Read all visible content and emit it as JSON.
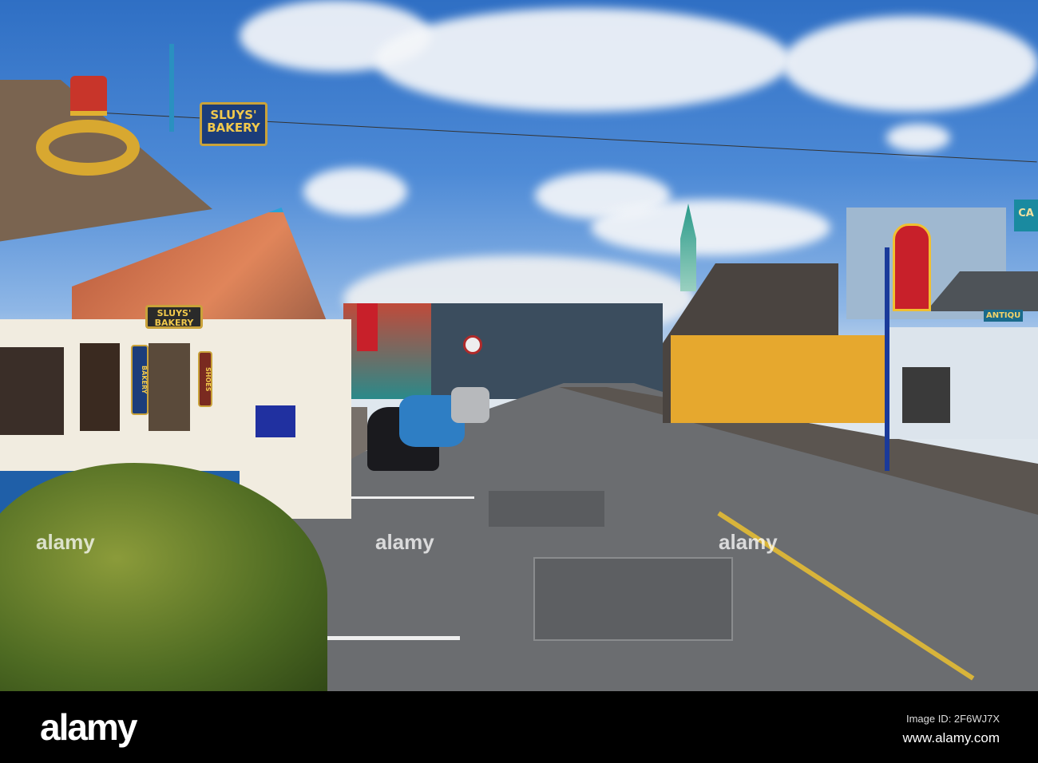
{
  "photo": {
    "signs": {
      "hanging_sign": "SLUYS' BAKERY",
      "storefront_sign": "SLUYS' BAKERY",
      "vertical_bakery_sign": "BAKERY",
      "shoes_sign": "SHOES",
      "antique_sign": "ANTIQU",
      "cafe_sign": "CA"
    },
    "watermark": "alamy"
  },
  "footer": {
    "logo": "alamy",
    "image_id": "Image ID: 2F6WJ7X",
    "website": "www.alamy.com"
  }
}
